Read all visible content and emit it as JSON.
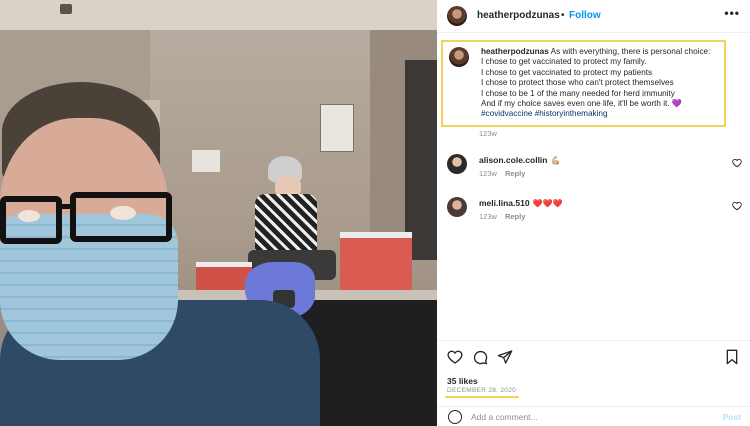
{
  "post": {
    "author": "heatherpodzunas",
    "separator": "•",
    "follow_label": "Follow",
    "more_icon": "more-horizontal-icon",
    "caption": {
      "username": "heatherpodzunas",
      "lines": [
        "As with everything, there is personal choice:",
        "I chose to get vaccinated to protect my family.",
        "I chose to get vaccinated to protect my patients",
        "I chose to protect those who can't protect themselves",
        "I chose to be 1 of the many needed for herd immunity",
        "And if my choice saves even one life, it'll be worth it."
      ],
      "emoji": "💜",
      "hashtags": "#covidvaccine #historyinthemaking",
      "age": "123w"
    },
    "comments": [
      {
        "username": "alison.cole.collin",
        "emoji": "💪🏼",
        "age": "123w",
        "reply_label": "Reply"
      },
      {
        "username": "meli.lina.510",
        "emoji": "❤️❤️❤️",
        "age": "123w",
        "reply_label": "Reply"
      }
    ],
    "likes": "35 likes",
    "date": "DECEMBER 28, 2020",
    "add_comment_placeholder": "Add a comment...",
    "post_label": "Post",
    "highlight_color": "#f1d35c",
    "accent_color": "#0095f6"
  }
}
